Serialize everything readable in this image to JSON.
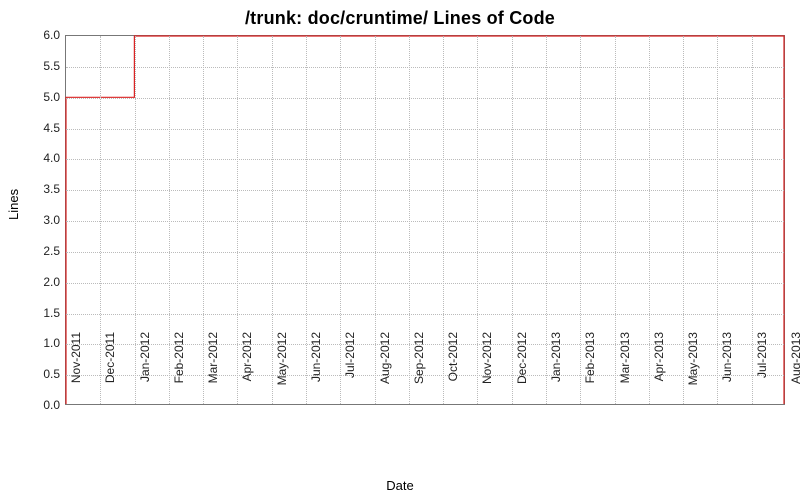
{
  "chart_data": {
    "type": "line",
    "title": "/trunk: doc/cruntime/ Lines of Code",
    "xlabel": "Date",
    "ylabel": "Lines",
    "ylim": [
      0.0,
      6.0
    ],
    "y_ticks": [
      0.0,
      0.5,
      1.0,
      1.5,
      2.0,
      2.5,
      3.0,
      3.5,
      4.0,
      4.5,
      5.0,
      5.5,
      6.0
    ],
    "y_tick_labels": [
      "0.0",
      "0.5",
      "1.0",
      "1.5",
      "2.0",
      "2.5",
      "3.0",
      "3.5",
      "4.0",
      "4.5",
      "5.0",
      "5.5",
      "6.0"
    ],
    "x_categories": [
      "Nov-2011",
      "Dec-2011",
      "Jan-2012",
      "Feb-2012",
      "Mar-2012",
      "Apr-2012",
      "May-2012",
      "Jun-2012",
      "Jul-2012",
      "Aug-2012",
      "Sep-2012",
      "Oct-2012",
      "Nov-2012",
      "Dec-2012",
      "Jan-2013",
      "Feb-2013",
      "Mar-2013",
      "Apr-2013",
      "May-2013",
      "Jun-2013",
      "Jul-2013",
      "Aug-2013"
    ],
    "series": [
      {
        "name": "Lines of Code",
        "color": "#d92020",
        "points": [
          {
            "x": "Nov-2011",
            "y": 0
          },
          {
            "x": "Nov-2011",
            "y": 5
          },
          {
            "x": "Jan-2012",
            "y": 5
          },
          {
            "x": "Jan-2012",
            "y": 6
          },
          {
            "x": "Aug-2013",
            "y": 6
          },
          {
            "x": "Aug-2013",
            "y": 0
          }
        ]
      }
    ]
  }
}
